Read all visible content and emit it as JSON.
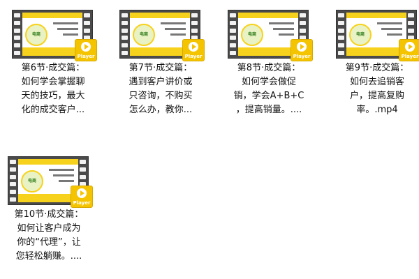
{
  "files": [
    {
      "player_label": "Player",
      "mascot_label": "电商",
      "caption_lines": [
        "第6节·成交篇：",
        "如何学会掌握聊",
        "天的技巧，最大",
        "化的成交客户..."
      ]
    },
    {
      "player_label": "Player",
      "mascot_label": "电商",
      "caption_lines": [
        "第7节·成交篇：",
        "遇到客户讲价或",
        "只咨询，不购买",
        "怎么办，教你..."
      ]
    },
    {
      "player_label": "Player",
      "mascot_label": "电商",
      "caption_lines": [
        "第8节·成交篇：",
        "如何学会做促",
        "销，学会A+B+C",
        "，提高销量。...."
      ]
    },
    {
      "player_label": "Player",
      "mascot_label": "电商",
      "caption_lines": [
        "第9节·成交篇：",
        "如何去追销客",
        "户，提高复购",
        "率。.mp4"
      ]
    },
    {
      "player_label": "Player",
      "mascot_label": "电商",
      "caption_lines": [
        "第10节·成交篇：",
        "如何让客户成为",
        "你的“代理”，让",
        "您轻松躺赚。...."
      ]
    }
  ],
  "colors": {
    "accent_yellow": "#f7d21c",
    "film_gray": "#4a4a4a",
    "player_badge": "#f5c400"
  },
  "icons": {
    "thumbnail": "video-film-strip-icon",
    "badge": "player-play-icon"
  }
}
